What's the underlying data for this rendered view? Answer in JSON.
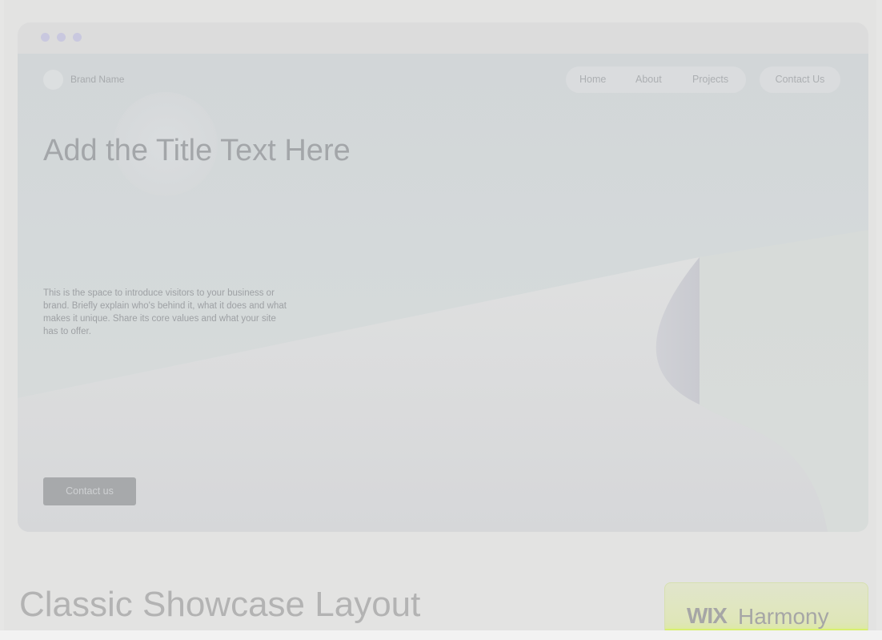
{
  "preview": {
    "brand_name": "Brand Name",
    "nav": [
      "Home",
      "About",
      "Projects"
    ],
    "contact_nav": "Contact Us",
    "title": "Add the Title Text Here",
    "description": "This is the space to introduce visitors to your business or brand. Briefly explain who's behind it, what it does and what makes it unique. Share its core values and what your site has to offer.",
    "cta": "Contact us"
  },
  "layout_name": "Classic Showcase Layout",
  "badge": {
    "brand": "WIX",
    "product": "Harmony"
  },
  "colors": {
    "background": "#e6e6e5",
    "window_dots": "#c9c8df",
    "badge_accent": "#d8f070"
  }
}
